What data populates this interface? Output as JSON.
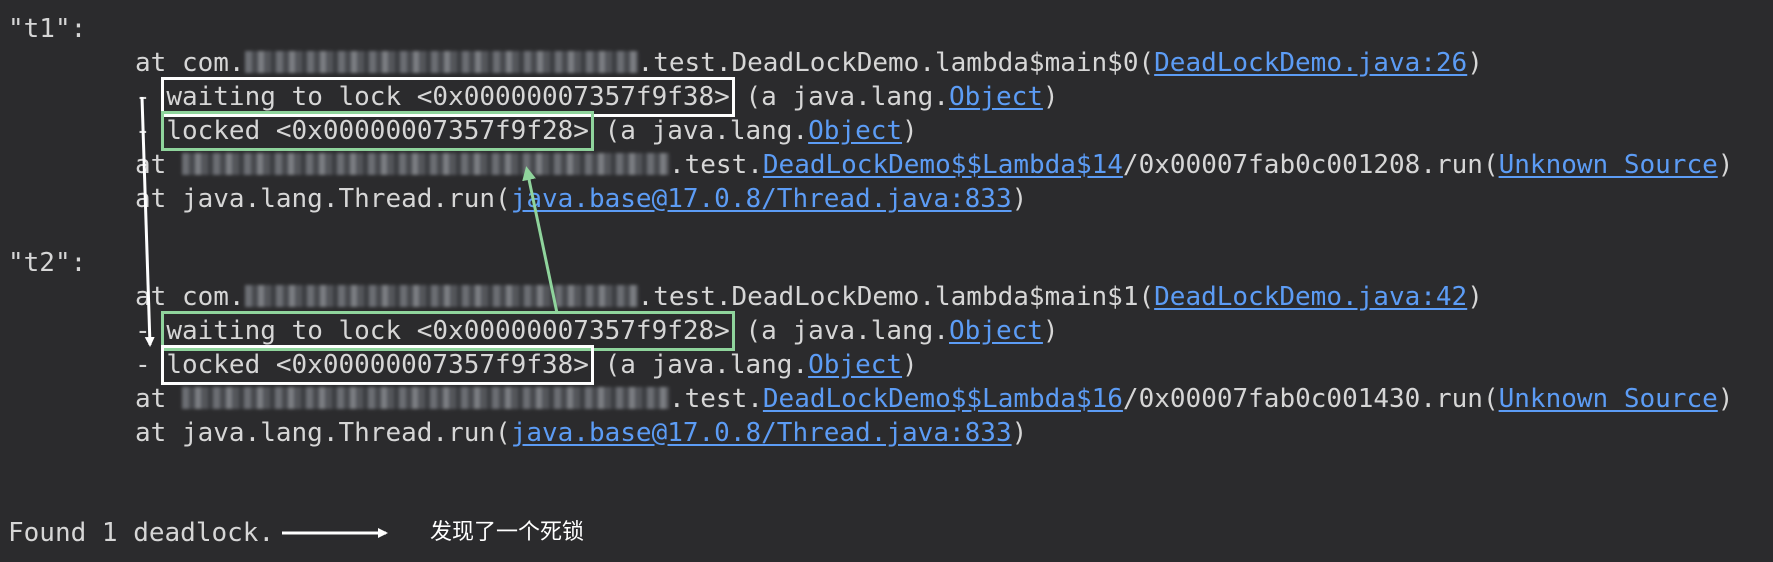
{
  "threads": [
    {
      "name": "\"t1\":",
      "frames": {
        "f1_at": "at com.",
        "f1_suffix": ".test.DeadLockDemo.lambda$main$0(",
        "f1_link": "DeadLockDemo.java:26",
        "f1_close": ")",
        "waiting_dash": "- ",
        "waiting_text": "waiting to lock <0x00000007357f9f38>",
        "waiting_mid": " (a java.lang.",
        "waiting_link": "Object",
        "waiting_close": ")",
        "locked_dash": "- ",
        "locked_text": "locked <0x00000007357f9f28>",
        "locked_mid": " (a java.lang.",
        "locked_link": "Object",
        "locked_close": ")",
        "f2_at": "at ",
        "f2_suffix": ".test.",
        "f2_link": "DeadLockDemo$$Lambda$14",
        "f2_mid": "/0x00007fab0c001208.run(",
        "f2_link2": "Unknown Source",
        "f2_close": ")",
        "f3_prefix": "at java.lang.Thread.run(",
        "f3_link": "java.base@17.0.8/Thread.java:833",
        "f3_close": ")"
      }
    },
    {
      "name": "\"t2\":",
      "frames": {
        "f1_at": "at com.",
        "f1_suffix": ".test.DeadLockDemo.lambda$main$1(",
        "f1_link": "DeadLockDemo.java:42",
        "f1_close": ")",
        "waiting_dash": "- ",
        "waiting_text": "waiting to lock <0x00000007357f9f28>",
        "waiting_mid": " (a java.lang.",
        "waiting_link": "Object",
        "waiting_close": ")",
        "locked_dash": "- ",
        "locked_text": "locked <0x00000007357f9f38>",
        "locked_mid": " (a java.lang.",
        "locked_link": "Object",
        "locked_close": ")",
        "f2_at": "at ",
        "f2_suffix": ".test.",
        "f2_link": "DeadLockDemo$$Lambda$16",
        "f2_mid": "/0x00007fab0c001430.run(",
        "f2_link2": "Unknown Source",
        "f2_close": ")",
        "f3_prefix": "at java.lang.Thread.run(",
        "f3_link": "java.base@17.0.8/Thread.java:833",
        "f3_close": ")"
      }
    }
  ],
  "footer": {
    "found": "Found 1 deadlock.",
    "annotation": "发现了一个死锁"
  },
  "colors": {
    "background": "#2b2b2d",
    "text": "#d6d6d6",
    "link": "#5c9cf5",
    "box_white": "#ffffff",
    "box_green": "#8fd49c"
  }
}
